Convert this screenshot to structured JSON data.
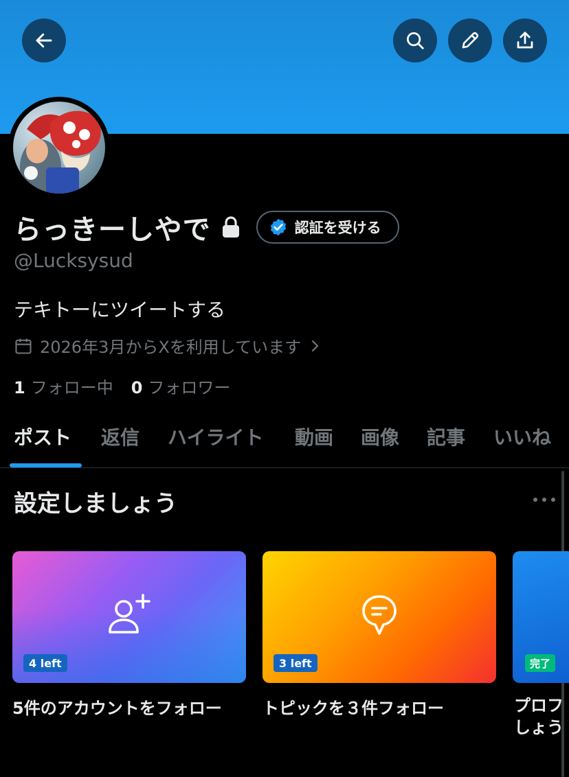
{
  "profile": {
    "display_name": "らっきーしやで",
    "handle": "@Lucksysud",
    "bio": "テキトーにツイートする",
    "joined": "2026年3月からXを利用しています",
    "verify_button": "認証を受ける"
  },
  "stats": {
    "following_count": "1",
    "following_label": "フォロー中",
    "followers_count": "0",
    "followers_label": "フォロワー"
  },
  "tabs": [
    {
      "label": "ポスト",
      "active": true
    },
    {
      "label": "返信"
    },
    {
      "label": "ハイライト"
    },
    {
      "label": "動画"
    },
    {
      "label": "画像"
    },
    {
      "label": "記事"
    },
    {
      "label": "いいね"
    }
  ],
  "setup": {
    "title": "設定しましょう",
    "cards": [
      {
        "badge": "4 left",
        "caption": "5件のアカウントをフォロー",
        "icon": "add-user-icon"
      },
      {
        "badge": "3 left",
        "caption": "トピックを３件フォロー",
        "icon": "topic-bubble-icon"
      },
      {
        "badge": "完了",
        "caption": "プロフ しょう"
      }
    ]
  },
  "icons": {
    "back": "arrow-left-icon",
    "search": "search-icon",
    "edit": "pencil-icon",
    "share": "share-icon",
    "lock": "lock-icon",
    "verified": "verified-badge-icon",
    "calendar": "calendar-icon"
  },
  "colors": {
    "accent": "#1d9bf0",
    "banner": "#1d9bf0",
    "background": "#000000",
    "done": "#00ba7c"
  }
}
